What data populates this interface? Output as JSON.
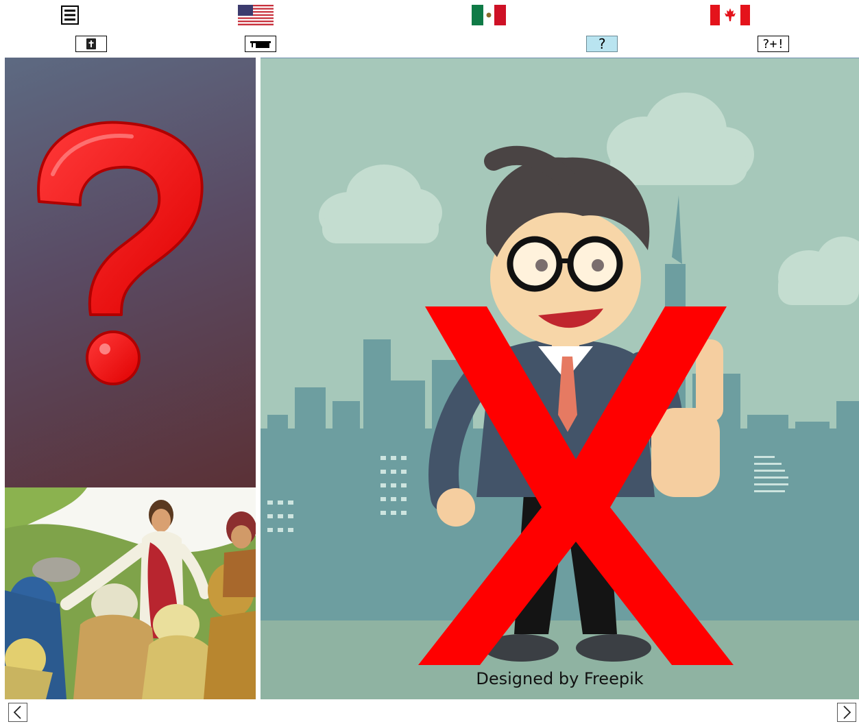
{
  "toolbar": {
    "menu_icon": "hamburger-menu-icon",
    "flags": [
      {
        "name": "us-flag",
        "label": "English (US)"
      },
      {
        "name": "mexico-flag",
        "label": "Español (MX)"
      },
      {
        "name": "canada-flag",
        "label": "Français (CA)"
      }
    ],
    "buttons": [
      {
        "name": "bible-button",
        "icon": "bible-icon"
      },
      {
        "name": "teacher-button",
        "icon": "graduation-cap-icon"
      },
      {
        "name": "question-button",
        "label": "?"
      },
      {
        "name": "question-exclaim-button",
        "label": "?+!"
      }
    ]
  },
  "content": {
    "question_mark_icon": "red-question-mark-icon",
    "story_image": "jesus-with-disciples-illustration",
    "main_image": "businessman-thumbs-up-crossed-out-illustration",
    "credit": "Designed by Freepik"
  },
  "navigation": {
    "prev_icon": "chevron-left-icon",
    "next_icon": "chevron-right-icon"
  },
  "colors": {
    "active_button": "#b9e4f0",
    "cross_red": "#ff0000",
    "scene_bg": "#a6c8ba"
  }
}
